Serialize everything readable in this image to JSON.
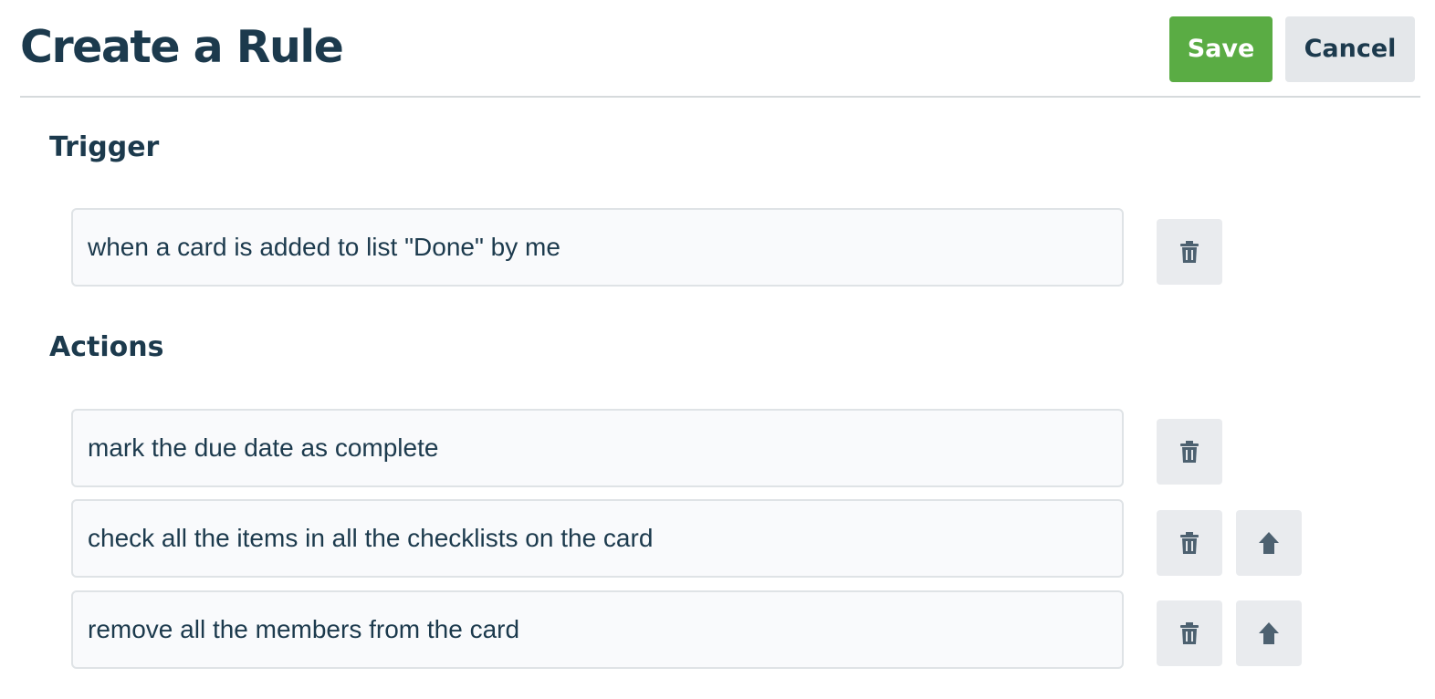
{
  "header": {
    "title": "Create a Rule",
    "save_label": "Save",
    "cancel_label": "Cancel"
  },
  "trigger": {
    "heading": "Trigger",
    "text": "when a card is added to list \"Done\" by me"
  },
  "actions": {
    "heading": "Actions",
    "items": [
      {
        "text": "mark the due date as complete"
      },
      {
        "text": "check all the items in all the checklists on the card"
      },
      {
        "text": "remove all the members from the card"
      }
    ]
  },
  "icons": {
    "delete": "trash-icon",
    "move_up": "arrow-up-icon"
  },
  "colors": {
    "primary_text": "#1c3a4d",
    "save_button": "#5aac44",
    "neutral_button": "#e4e7ea",
    "icon": "#4d6170"
  }
}
